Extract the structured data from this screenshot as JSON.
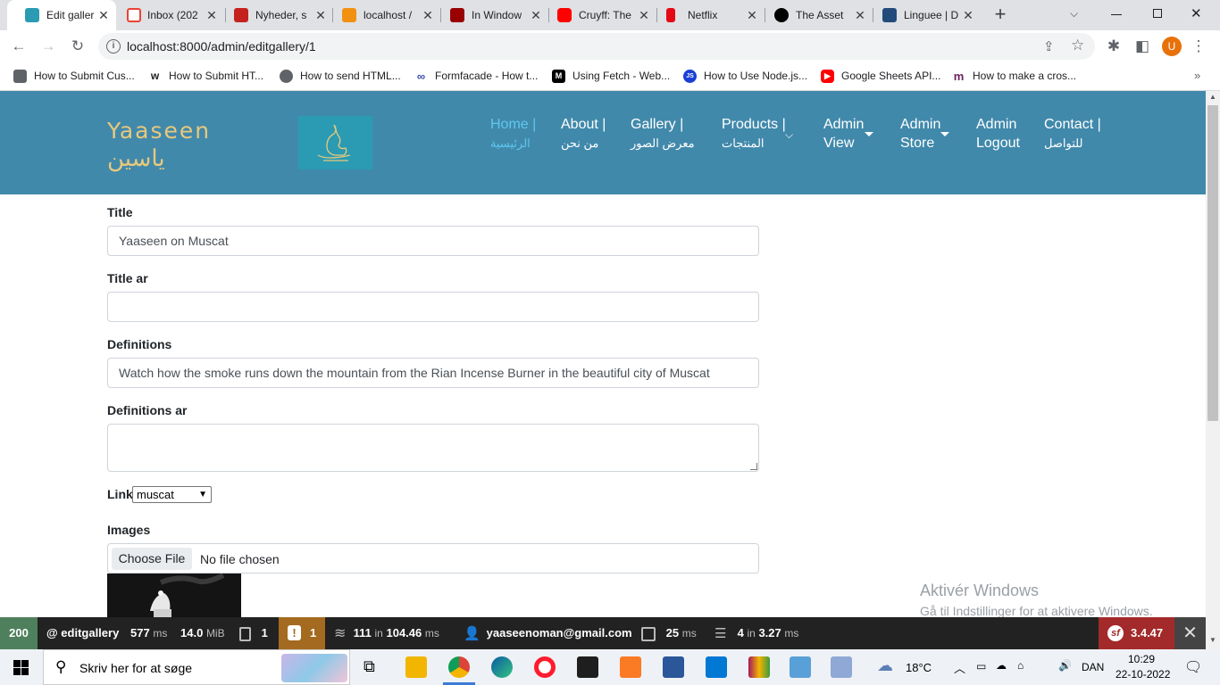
{
  "browser": {
    "tabs": [
      {
        "label": "Edit galler",
        "icon": "page-favicon",
        "color": "#2a9bb3"
      },
      {
        "label": "Inbox (202",
        "icon": "gmail-icon",
        "color": "#ea4335"
      },
      {
        "label": "Nyheder, s",
        "icon": "news-icon",
        "color": "#c5221f"
      },
      {
        "label": "localhost /",
        "icon": "phpmyadmin-icon",
        "color": "#f29111"
      },
      {
        "label": "In Window",
        "icon": "iu-icon",
        "color": "#990000"
      },
      {
        "label": "Cruyff: The",
        "icon": "youtube-icon",
        "color": "#ff0000"
      },
      {
        "label": "Netflix",
        "icon": "netflix-icon",
        "color": "#e50914"
      },
      {
        "label": "The Asset",
        "icon": "symfony-icon",
        "color": "#000000"
      },
      {
        "label": "Linguee | D",
        "icon": "linguee-icon",
        "color": "#224b7c"
      }
    ],
    "new_tab": "+",
    "url": "localhost:8000/admin/editgallery/1",
    "profile_initial": "U",
    "bookmarks": [
      {
        "label": "How to Submit Cus...",
        "icon": "w3-icon",
        "color": "#5f6368"
      },
      {
        "label": "How to Submit HT...",
        "icon": "wikihow-icon",
        "color": "#202124"
      },
      {
        "label": "How to send HTML...",
        "icon": "globe-icon",
        "color": "#5f6368"
      },
      {
        "label": "Formfacade - How t...",
        "icon": "infinity-icon",
        "color": "#3949ab"
      },
      {
        "label": "Using Fetch - Web...",
        "icon": "mdn-icon",
        "color": "#000000"
      },
      {
        "label": "How to Use Node.js...",
        "icon": "js-icon",
        "color": "#1a3fd6"
      },
      {
        "label": "Google Sheets API...",
        "icon": "youtube-icon",
        "color": "#ff0000"
      },
      {
        "label": "How to make a cros...",
        "icon": "m-icon",
        "color": "#6b1f5b"
      }
    ]
  },
  "site": {
    "brand_en": "Yaaseen",
    "brand_ar": "ياسين",
    "nav": [
      {
        "label": "Home |",
        "sub": "الرئيسية",
        "active": true
      },
      {
        "label": "About |",
        "sub": "من نحن"
      },
      {
        "label": "Gallery |",
        "sub": "معرض الصور"
      },
      {
        "label": "Products |",
        "sub": "المنتجات",
        "dropdown": true
      },
      {
        "label": "Admin",
        "sub": "View",
        "dropdown": true
      },
      {
        "label": "Admin",
        "sub": "Store",
        "dropdown": true
      },
      {
        "label": "Admin",
        "sub": "Logout"
      },
      {
        "label": "Contact |",
        "sub": "للتواصل"
      }
    ]
  },
  "form": {
    "title_label": "Title",
    "title_value": "Yaaseen on Muscat",
    "title_ar_label": "Title ar",
    "title_ar_value": "",
    "definitions_label": "Definitions",
    "definitions_value": "Watch how the smoke runs down the mountain from the Rian Incense Burner in the beautiful city of Muscat",
    "definitions_ar_label": "Definitions ar",
    "definitions_ar_value": "",
    "link_label": "Link",
    "link_value": "muscat",
    "images_label": "Images",
    "choose_file": "Choose File",
    "no_file": "No file chosen"
  },
  "watermark": {
    "line1": "Aktivér Windows",
    "line2": "Gå til Indstillinger for at aktivere Windows."
  },
  "symfony_toolbar": {
    "status": "200",
    "route": "@ editgallery",
    "time": "577",
    "time_unit": "ms",
    "memory": "14.0",
    "memory_unit": "MiB",
    "logs": "1",
    "warnings": "1",
    "db_queries": "111",
    "db_in": "in",
    "db_time": "104.46",
    "db_unit": "ms",
    "user": "yaaseenoman@gmail.com",
    "twig_time": "25",
    "twig_unit": "ms",
    "cache": "4",
    "cache_in": "in",
    "cache_time": "3.27",
    "cache_unit": "ms",
    "version": "3.4.47",
    "close": "✕"
  },
  "taskbar": {
    "search_placeholder": "Skriv her for at søge",
    "weather": "18°C",
    "language": "DAN",
    "time": "10:29",
    "date": "22-10-2022"
  }
}
